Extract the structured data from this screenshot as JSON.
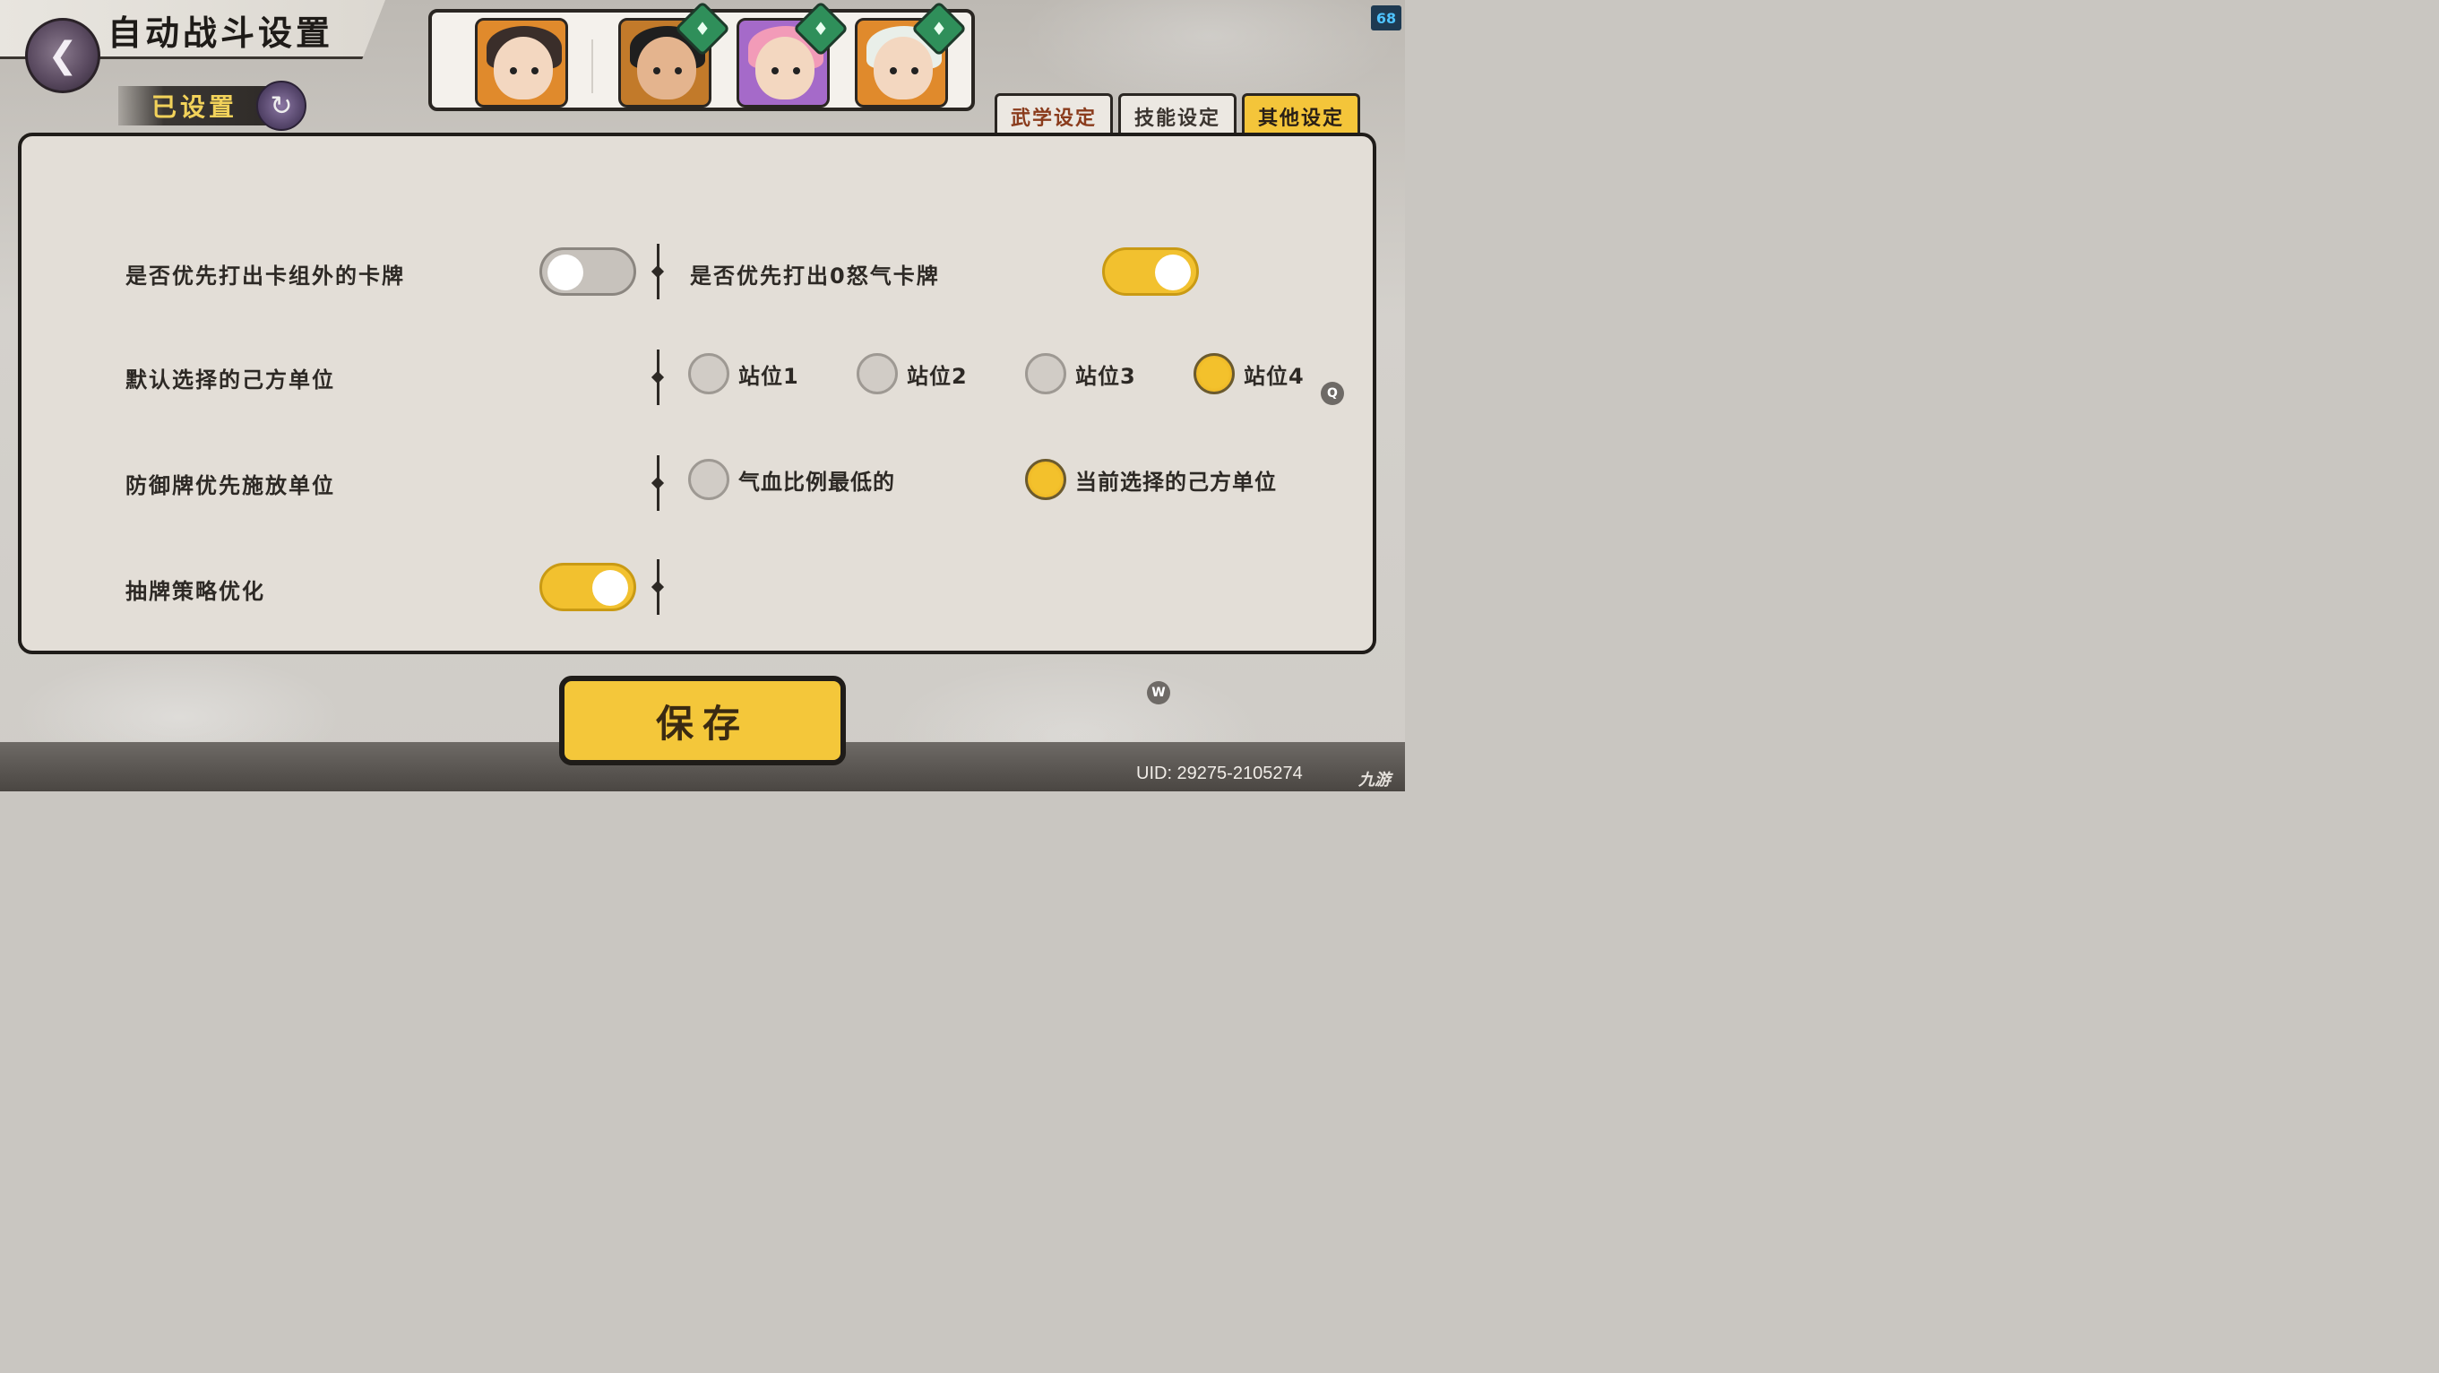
{
  "header": {
    "title": "自动战斗设置",
    "status": "已设置",
    "fps": "68"
  },
  "heroes": [
    {
      "name": "hero-1",
      "badge": ""
    },
    {
      "name": "hero-2",
      "badge": "♦"
    },
    {
      "name": "hero-3",
      "badge": "♦"
    },
    {
      "name": "hero-4",
      "badge": "♦"
    }
  ],
  "tabs": [
    {
      "label": "武学设定",
      "active": false
    },
    {
      "label": "技能设定",
      "active": false
    },
    {
      "label": "其他设定",
      "active": true
    }
  ],
  "settings": {
    "row1_label": "是否优先打出卡组外的卡牌",
    "row1_toggle": "off",
    "row1b_label": "是否优先打出0怒气卡牌",
    "row1b_toggle": "on",
    "row2_label": "默认选择的己方单位",
    "row2_options": [
      "站位1",
      "站位2",
      "站位3",
      "站位4"
    ],
    "row2_selected": "站位4",
    "row3_label": "防御牌优先施放单位",
    "row3_options": [
      "气血比例最低的",
      "当前选择的己方单位"
    ],
    "row3_selected": "当前选择的己方单位",
    "row4_label": "抽牌策略优化",
    "row4_toggle": "on"
  },
  "hints": {
    "q": "Q",
    "w": "W"
  },
  "save_label": "保存",
  "footer": {
    "uid": "UID: 29275-2105274",
    "watermark": "九游"
  },
  "colors": {
    "accent": "#f4c53a",
    "panel": "#e3ded7",
    "border": "#1f1c19"
  }
}
